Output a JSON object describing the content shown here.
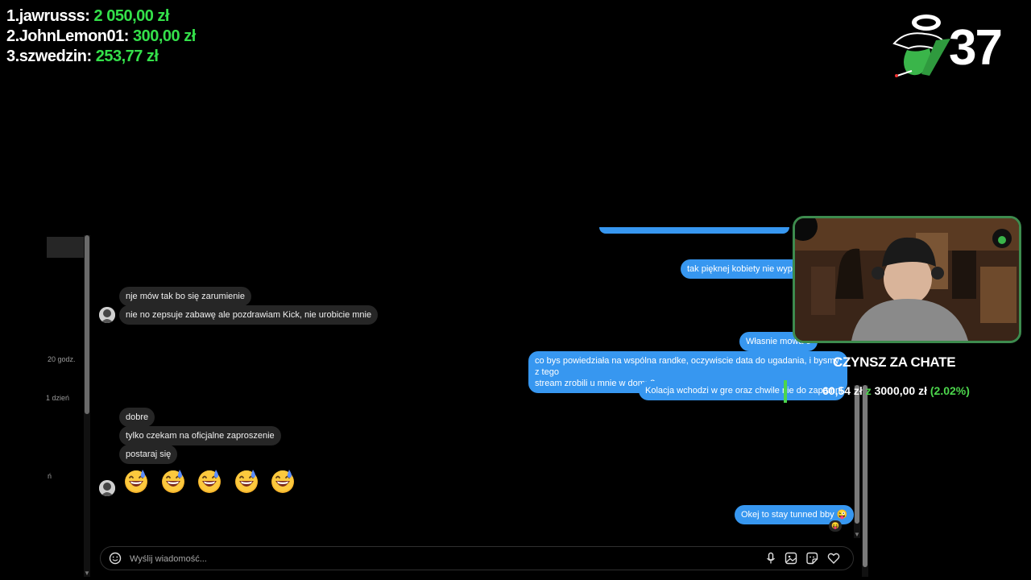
{
  "leaderboard": [
    {
      "rank": "1.",
      "name": "jawrusss:",
      "amount": "2 050,00 zł"
    },
    {
      "rank": "2.",
      "name": "JohnLemon01:",
      "amount": "300,00 zł"
    },
    {
      "rank": "3.",
      "name": "szwedzin:",
      "amount": "253,77 zł"
    }
  ],
  "counter": "37",
  "timestamps": {
    "t1": "20 godz.",
    "t2": "1 dzień",
    "t3": "ń"
  },
  "messages": {
    "in1": "nje mów tak bo się zarumienie",
    "in2": "nie no zepsuje zabawę ale pozdrawiam Kick, nie urobicie mnie",
    "in3": "dobre",
    "in4": "tylko czekam na oficjalne zaproszenie",
    "in5": "postaraj się",
    "out0": "...",
    "out1": "tak pięknej kobiety nie wypad",
    "out2": "Własnie mowa o",
    "out3_line1": "co bys powiedziała na wspólna randke, oczywiscie data do ugadania, i bysmy z tego",
    "out3_line2": "stream zrobili u mnie w domu?",
    "out4": "Kolacja wchodzi w gre oraz chwile nie do zapomni",
    "out5": "Okej to stay tunned bby 😜"
  },
  "emoji_count": 5,
  "reaction": "😝",
  "composer": {
    "placeholder": "Wyślij wiadomość..."
  },
  "icons": [
    "emoji-icon",
    "microphone-icon",
    "image-icon",
    "sticker-icon",
    "heart-icon"
  ],
  "overlay": {
    "rent_title": "CZYNSZ ZA CHATE",
    "rent_current": "60,54 zł",
    "rent_of": "z",
    "rent_goal": "3000,00 zł",
    "rent_percent": "(2.02%)",
    "rent_fraction": 0.0202
  },
  "colors": {
    "accent_green": "#34e04a",
    "bubble_out": "#3797f0",
    "bubble_in": "#262626",
    "cam_border": "#3d8b4e"
  }
}
